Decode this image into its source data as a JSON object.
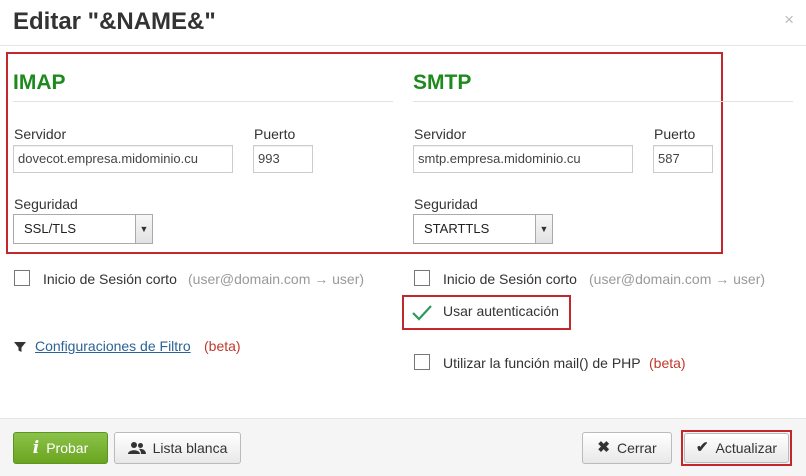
{
  "dialog": {
    "title": "Editar \"&NAME&\"",
    "close": "×"
  },
  "imap": {
    "heading": "IMAP",
    "server_label": "Servidor",
    "server_value": "dovecot.empresa.midominio.cu",
    "port_label": "Puerto",
    "port_value": "993",
    "security_label": "Seguridad",
    "security_value": "SSL/TLS"
  },
  "smtp": {
    "heading": "SMTP",
    "server_label": "Servidor",
    "server_value": "smtp.empresa.midominio.cu",
    "port_label": "Puerto",
    "port_value": "587",
    "security_label": "Seguridad",
    "security_value": "STARTTLS"
  },
  "options": {
    "imap_short_login_label": "Inicio de Sesión corto",
    "imap_short_login_hint": "(user@domain.com → user)",
    "smtp_short_login_label": "Inicio de Sesión corto",
    "smtp_short_login_hint": "(user@domain.com → user)",
    "use_auth_label": "Usar autenticación",
    "filter_link": "Configuraciones de Filtro",
    "filter_beta": "(beta)",
    "php_mail_label": "Utilizar la función mail() de PHP",
    "php_mail_beta": "(beta)"
  },
  "footer": {
    "test_label": "Probar",
    "whitelist_label": "Lista blanca",
    "close_label": "Cerrar",
    "update_label": "Actualizar"
  },
  "colors": {
    "accent_green": "#1e8a1e",
    "highlight_red": "#c1272d",
    "beta_red": "#c0392b"
  }
}
